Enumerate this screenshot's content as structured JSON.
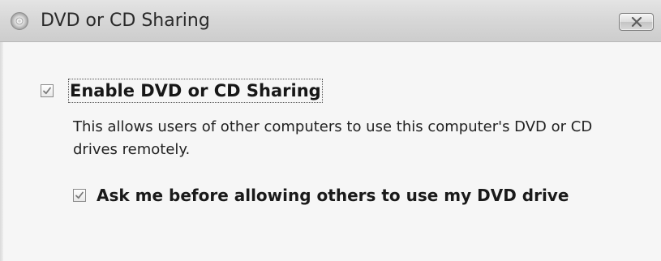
{
  "window": {
    "title": "DVD or CD Sharing",
    "icon": "dvd-disc-icon",
    "close_icon": "close-icon"
  },
  "options": {
    "enable_sharing": {
      "label": "Enable DVD or CD Sharing",
      "checked": true
    },
    "description": "This allows users of other computers to use this computer's DVD or CD drives remotely.",
    "ask_before_allowing": {
      "label": "Ask me before allowing others to use my DVD drive",
      "checked": true
    }
  }
}
